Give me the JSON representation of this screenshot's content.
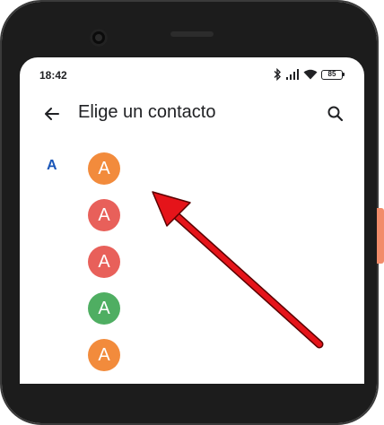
{
  "status_bar": {
    "time": "18:42",
    "battery_level": "85",
    "icons": [
      "bluetooth-icon",
      "signal-icon",
      "wifi-icon",
      "battery-icon"
    ]
  },
  "app_bar": {
    "title": "Elige un contacto",
    "back_icon": "arrow-back-icon",
    "search_icon": "search-icon"
  },
  "contacts": {
    "section_letter": "A",
    "items": [
      {
        "initial": "A",
        "color": "#f28b3c"
      },
      {
        "initial": "A",
        "color": "#e8605a"
      },
      {
        "initial": "A",
        "color": "#e8605a"
      },
      {
        "initial": "A",
        "color": "#4fae62"
      },
      {
        "initial": "A",
        "color": "#f28b3c"
      }
    ]
  },
  "annotation": {
    "arrow_color": "#e5141a"
  }
}
